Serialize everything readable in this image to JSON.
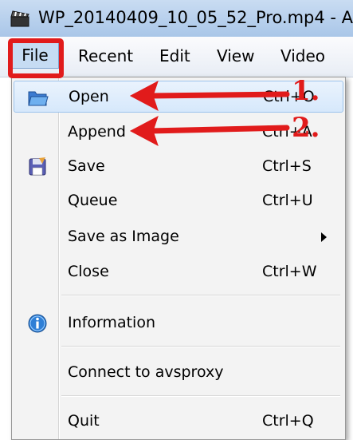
{
  "window": {
    "title": "WP_20140409_10_05_52_Pro.mp4 - A",
    "app_icon": "clapperboard-icon"
  },
  "menubar": {
    "items": [
      {
        "label": "File"
      },
      {
        "label": "Recent"
      },
      {
        "label": "Edit"
      },
      {
        "label": "View"
      },
      {
        "label": "Video"
      }
    ]
  },
  "file_menu": {
    "items": [
      {
        "label": "Open",
        "shortcut": "Ctrl+O",
        "icon": "open-folder-icon"
      },
      {
        "label": "Append",
        "shortcut": "Ctrl+A"
      },
      {
        "label": "Save",
        "shortcut": "Ctrl+S",
        "icon": "save-disk-icon"
      },
      {
        "label": "Queue",
        "shortcut": "Ctrl+U"
      },
      {
        "label": "Save as Image",
        "submenu": true
      },
      {
        "label": "Close",
        "shortcut": "Ctrl+W"
      },
      {
        "label": "Information",
        "icon": "info-icon"
      },
      {
        "label": "Connect to avsproxy"
      },
      {
        "label": "Quit",
        "shortcut": "Ctrl+Q"
      }
    ]
  },
  "annotations": {
    "step1": "1.",
    "step2": "2.",
    "color": "#e11b1b"
  }
}
